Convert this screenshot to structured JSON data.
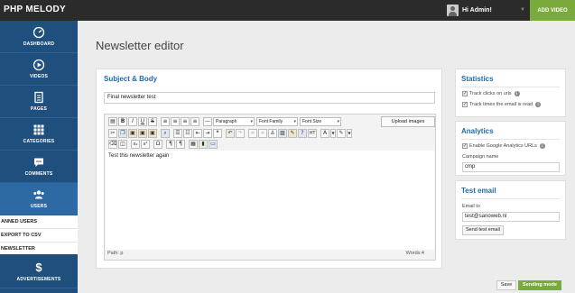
{
  "app": {
    "brand": "PHP MELODY"
  },
  "topbar": {
    "greeting": "Hi Admin!",
    "add_video": "ADD VIDEO"
  },
  "sidebar": {
    "items": [
      {
        "label": "DASHBOARD",
        "icon": "gauge-icon"
      },
      {
        "label": "VIDEOS",
        "icon": "play-icon"
      },
      {
        "label": "PAGES",
        "icon": "document-icon"
      },
      {
        "label": "CATEGORIES",
        "icon": "grid-icon"
      },
      {
        "label": "COMMENTS",
        "icon": "comment-icon"
      },
      {
        "label": "USERS",
        "icon": "users-icon"
      }
    ],
    "subitems": [
      "ANNED USERS",
      "EXPORT TO CSV",
      "NEWSLETTER"
    ],
    "last_item": {
      "label": "ADVERTISEMENTS",
      "icon": "dollar-icon"
    }
  },
  "page": {
    "title": "Newsletter editor"
  },
  "subject_panel": {
    "heading": "Subject & Body",
    "subject_value": "Final newsletter test",
    "editor": {
      "format_select": "Paragraph",
      "font_family_select": "Font Family",
      "font_size_select": "Font Size",
      "upload_label": "Upload images",
      "body_text": "Test this newsletter again",
      "path_label": "Path: p",
      "words_label": "Words:4"
    }
  },
  "statistics": {
    "heading": "Statistics",
    "track_clicks": "Track clicks on urls",
    "track_opens": "Track times the email is read"
  },
  "analytics": {
    "heading": "Analytics",
    "enable_label": "Enable Google Analytics URLs",
    "campaign_label": "Campaign name",
    "campaign_value": "cmp"
  },
  "test_email": {
    "heading": "Test email",
    "email_label": "Email to",
    "email_value": "test@sanoweb.nl",
    "send_button": "Send test email"
  },
  "footer": {
    "save": "Save",
    "sending_mode": "Sending mode"
  },
  "colors": {
    "sidebar": "#1f4f7d",
    "accent_green": "#7aa93c",
    "heading_blue": "#1f6aa8"
  }
}
